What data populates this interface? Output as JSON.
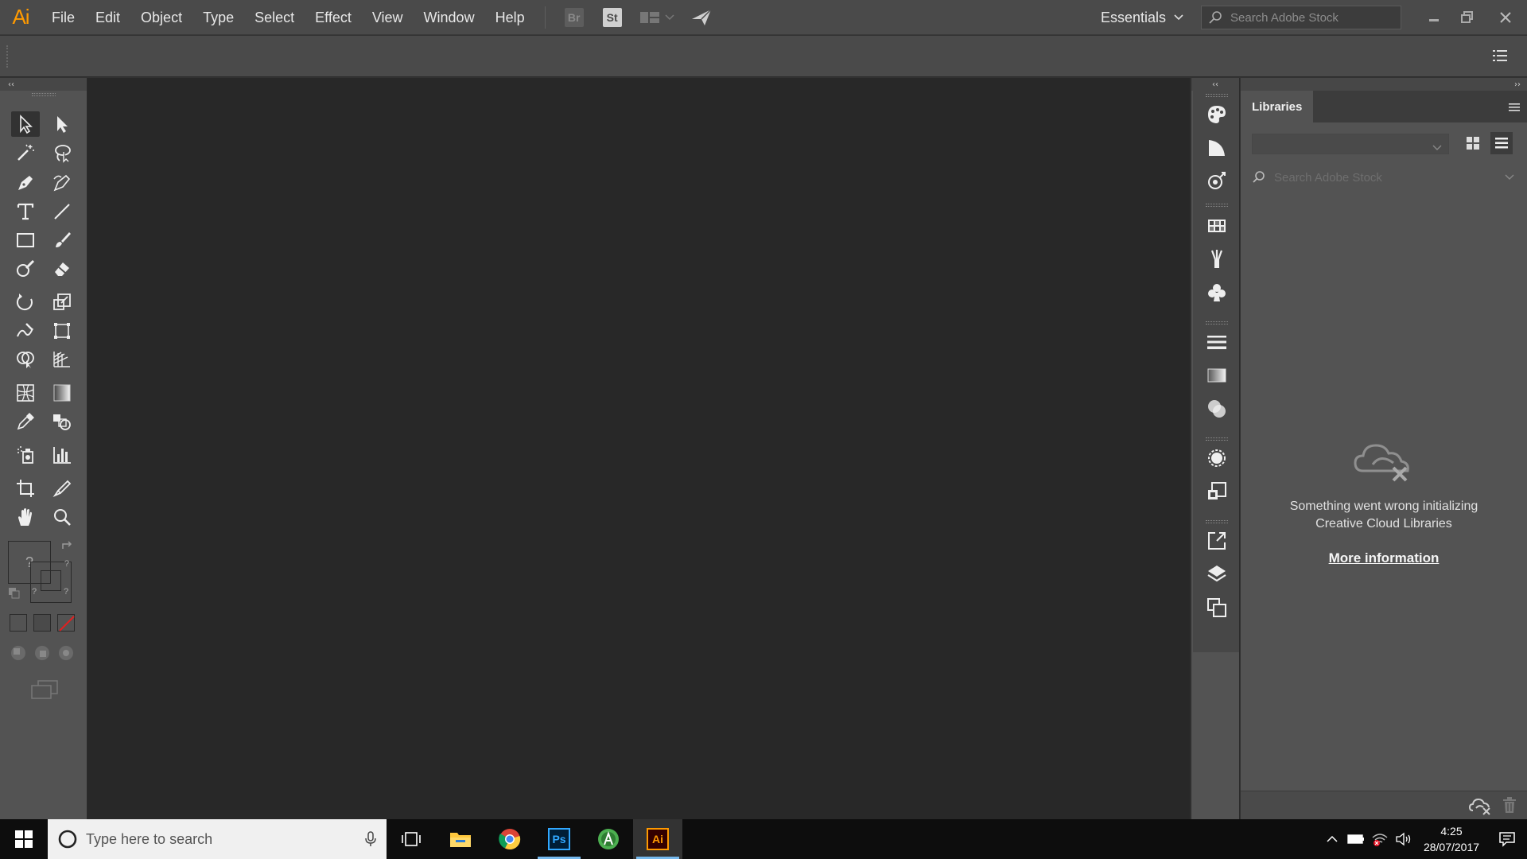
{
  "app": {
    "logo": "Ai",
    "menu": [
      "File",
      "Edit",
      "Object",
      "Type",
      "Select",
      "Effect",
      "View",
      "Window",
      "Help"
    ],
    "bridge_label": "Br",
    "stock_label": "St"
  },
  "topbar": {
    "workspace": "Essentials",
    "stock_search_placeholder": "Search Adobe Stock"
  },
  "toolbar": {
    "collapse_label": "‹‹",
    "unknown_color": "?"
  },
  "dock": {
    "collapse_label": "‹‹"
  },
  "libraries": {
    "expand_label": "››",
    "tab_label": "Libraries",
    "search_placeholder": "Search Adobe Stock",
    "error_line1": "Something went wrong initializing",
    "error_line2": "Creative Cloud Libraries",
    "more_info": "More information"
  },
  "taskbar": {
    "search_placeholder": "Type here to search",
    "ps_label": "Ps",
    "ai_label": "Ai",
    "time": "4:25",
    "date": "28/07/2017"
  },
  "colors": {
    "accent_ai": "#ff9a00",
    "accent_ps": "#31a8ff",
    "taskbar_active": "#76b9ed"
  }
}
